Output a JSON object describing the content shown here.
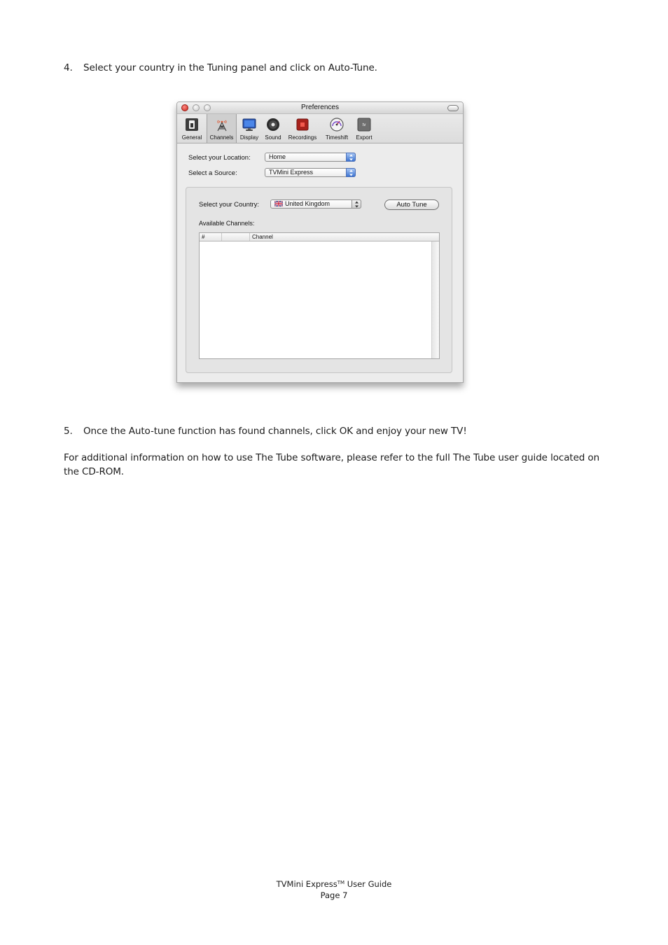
{
  "steps": [
    {
      "number": "4.",
      "text": "Select your country in the Tuning panel and click on Auto-Tune."
    },
    {
      "number": "5.",
      "text": "Once the Auto-tune function has found channels, click OK and enjoy your new TV!"
    }
  ],
  "paragraph": "For additional information on how to use The Tube software, please refer to the full The Tube user guide located on the CD-ROM.",
  "window": {
    "title": "Preferences",
    "toolbar": [
      {
        "label": "General",
        "icon": "switch-icon"
      },
      {
        "label": "Channels",
        "icon": "antenna-icon",
        "selected": true
      },
      {
        "label": "Display",
        "icon": "monitor-icon"
      },
      {
        "label": "Sound",
        "icon": "speaker-icon"
      },
      {
        "label": "Recordings",
        "icon": "record-icon"
      },
      {
        "label": "Timeshift",
        "icon": "gauge-icon"
      },
      {
        "label": "Export",
        "icon": "appletv-icon"
      }
    ],
    "export_icon_text": "tv",
    "location": {
      "label": "Select your Location:",
      "value": "Home"
    },
    "source": {
      "label": "Select a Source:",
      "value": "TVMini Express"
    },
    "country": {
      "label": "Select your Country:",
      "value": "United Kingdom",
      "flag": "uk-flag-icon"
    },
    "auto_tune_label": "Auto Tune",
    "available_channels_label": "Available Channels:",
    "table": {
      "columns": [
        "#",
        "",
        "Channel"
      ],
      "rows": []
    }
  },
  "footer": {
    "product": "TVMini Express",
    "trademark": "TM",
    "guide": " User Guide",
    "page": "Page 7"
  },
  "colors": {
    "close_button": "#d9322a",
    "popup_arrows": "#3d74d1",
    "antenna_accent": "#e0522a"
  }
}
